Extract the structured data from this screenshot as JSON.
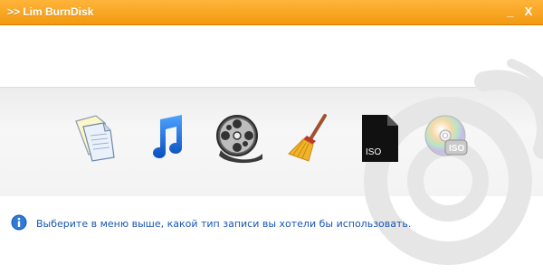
{
  "window": {
    "title": ">> Lim BurnDisk",
    "minimize_label": "_",
    "close_label": "X"
  },
  "toolbar": {
    "items": [
      {
        "icon": "documents-icon"
      },
      {
        "icon": "music-note-icon"
      },
      {
        "icon": "film-reel-icon"
      },
      {
        "icon": "broom-icon"
      },
      {
        "icon": "iso-file-icon",
        "label": "ISO"
      },
      {
        "icon": "disc-iso-icon",
        "label": "ISO"
      }
    ]
  },
  "status": {
    "message": "Выберите в меню выше, какой тип записи вы хотели бы использовать."
  },
  "colors": {
    "titlebar": "#f5a623",
    "accent_blue": "#1a56b4",
    "band": "#f2f2f2"
  }
}
